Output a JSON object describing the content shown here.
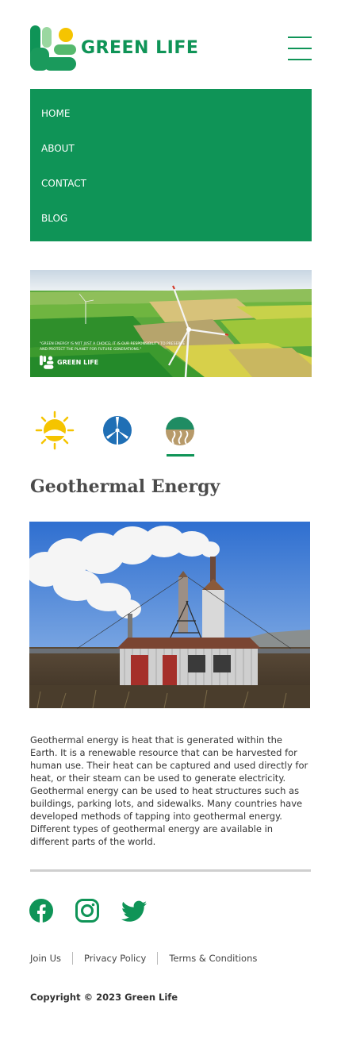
{
  "brand": {
    "name": "GREEN LIFE",
    "color": "#0f9457",
    "accent": "#f5c400"
  },
  "nav": {
    "items": [
      {
        "label": "HOME"
      },
      {
        "label": "ABOUT"
      },
      {
        "label": "CONTACT"
      },
      {
        "label": "BLOG"
      }
    ]
  },
  "banner": {
    "quote": "\"GREEN ENERGY IS NOT JUST A CHOICE; IT IS OUR RESPONSIBILITY TO PRESERVE AND PROTECT THE PLANET FOR FUTURE GENERATIONS.\"",
    "brand": "GREEN LIFE"
  },
  "tabs": [
    {
      "icon": "sun-icon",
      "active": false
    },
    {
      "icon": "wind-turbine-icon",
      "active": false
    },
    {
      "icon": "geothermal-icon",
      "active": true
    }
  ],
  "section": {
    "title": "Geothermal Energy",
    "description": "Geothermal energy is heat that is generated within the Earth. It is a renewable resource that can be harvested for human use. Their heat can be captured and used directly for heat, or their steam can be used to generate electricity. Geothermal energy can be used to heat structures such as buildings, parking lots, and sidewalks. Many countries have developed methods of tapping into geothermal energy. Different types of geothermal energy are available in different parts of the world."
  },
  "social": [
    {
      "icon": "facebook-icon"
    },
    {
      "icon": "instagram-icon"
    },
    {
      "icon": "twitter-icon"
    }
  ],
  "footer": {
    "links": [
      {
        "label": "Join Us"
      },
      {
        "label": "Privacy Policy"
      },
      {
        "label": "Terms & Conditions"
      }
    ],
    "copyright": "Copyright © 2023 Green Life"
  }
}
